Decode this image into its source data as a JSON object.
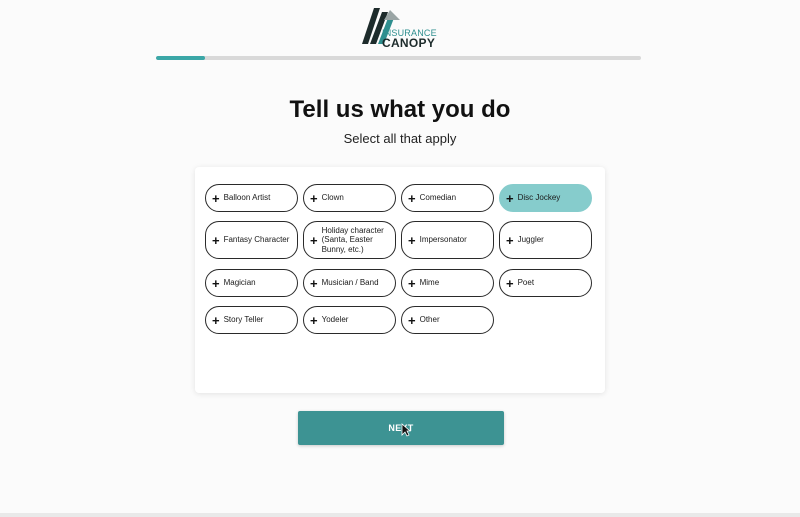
{
  "logo": {
    "line1": "INSURANCE",
    "line2": "CANOPY",
    "colors": {
      "teal": "#2f8f8f",
      "dark": "#1d2b2b"
    }
  },
  "progress": {
    "fraction": 0.1
  },
  "heading": {
    "title": "Tell us what you do",
    "subtitle": "Select all that apply"
  },
  "options": [
    {
      "label": "Balloon Artist",
      "selected": false
    },
    {
      "label": "Clown",
      "selected": false
    },
    {
      "label": "Comedian",
      "selected": false
    },
    {
      "label": "Disc Jockey",
      "selected": true
    },
    {
      "label": "Fantasy Character",
      "selected": false
    },
    {
      "label": "Holiday character (Santa, Easter Bunny, etc.)",
      "selected": false
    },
    {
      "label": "Impersonator",
      "selected": false
    },
    {
      "label": "Juggler",
      "selected": false
    },
    {
      "label": "Magician",
      "selected": false
    },
    {
      "label": "Musician / Band",
      "selected": false
    },
    {
      "label": "Mime",
      "selected": false
    },
    {
      "label": "Poet",
      "selected": false
    },
    {
      "label": "Story Teller",
      "selected": false
    },
    {
      "label": "Yodeler",
      "selected": false
    },
    {
      "label": "Other",
      "selected": false
    }
  ],
  "icons": {
    "option_icon": "plus-icon"
  },
  "next_button": {
    "label": "NEXT"
  },
  "colors": {
    "accent": "#3ba7a7",
    "button": "#3d9393",
    "selected": "#86cccc"
  }
}
